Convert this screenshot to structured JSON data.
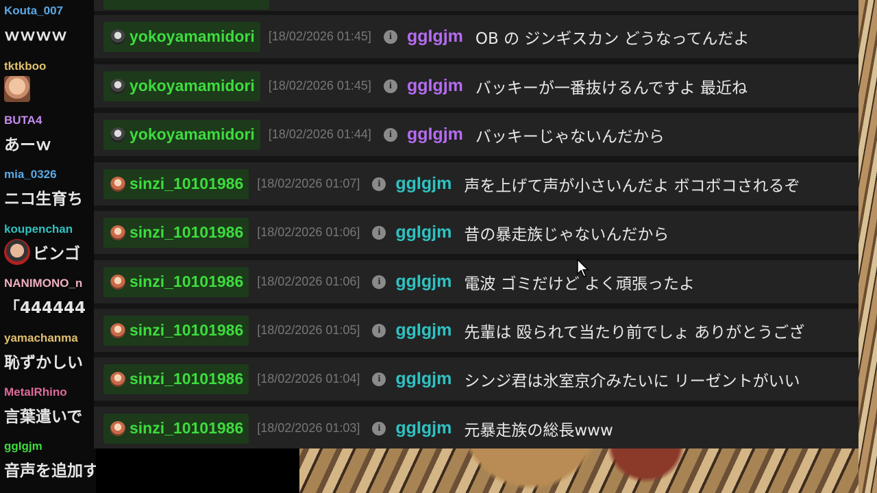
{
  "left_chat": [
    {
      "user": "Kouta_007",
      "user_color": "#5aa9e6",
      "text": "ｗｗｗｗ"
    },
    {
      "user": "tktkboo",
      "user_color": "#e0c070",
      "stamp": "face-stamp-icon"
    },
    {
      "user": "BUTA4",
      "user_color": "#c58bf0",
      "text": "あーｗ"
    },
    {
      "user": "mia_0326",
      "user_color": "#5aa9e6",
      "text": "ニコ生育ち"
    },
    {
      "user": "koupenchan",
      "user_color": "#2fc2c2",
      "text": "ビンゴ"
    },
    {
      "user": "NANIMONO_n",
      "user_color": "#f0b0c0",
      "text": "「444444"
    },
    {
      "user": "yamachanma",
      "user_color": "#e0c070",
      "text": "恥ずかしい"
    },
    {
      "user": "MetalRhino",
      "user_color": "#e06a9a",
      "text": "言葉遣いで"
    },
    {
      "user": "ggIgjm",
      "user_color": "#3ddc3d",
      "text": "音声を追加す"
    }
  ],
  "rows": [
    {
      "name": "yokoyamamidori",
      "icon": "yokoyama-avatar-icon",
      "timestamp": "[18/02/2026 01:45]",
      "to": "ggIgjm",
      "to_color": "purple",
      "message": "OB の ジンギスカン どうなってんだよ"
    },
    {
      "name": "yokoyamamidori",
      "icon": "yokoyama-avatar-icon",
      "timestamp": "[18/02/2026 01:45]",
      "to": "ggIgjm",
      "to_color": "purple",
      "message": "バッキーが一番抜けるんですよ 最近ね"
    },
    {
      "name": "yokoyamamidori",
      "icon": "yokoyama-avatar-icon",
      "timestamp": "[18/02/2026 01:44]",
      "to": "ggIgjm",
      "to_color": "purple",
      "message": "バッキーじゃないんだから"
    },
    {
      "name": "sinzi_10101986",
      "icon": "sinzi-avatar-icon",
      "timestamp": "[18/02/2026 01:07]",
      "to": "ggIgjm",
      "to_color": "teal",
      "message": "声を上げて声が小さいんだよ ボコボコされるぞ"
    },
    {
      "name": "sinzi_10101986",
      "icon": "sinzi-avatar-icon",
      "timestamp": "[18/02/2026 01:06]",
      "to": "ggIgjm",
      "to_color": "teal",
      "message": "昔の暴走族じゃないんだから"
    },
    {
      "name": "sinzi_10101986",
      "icon": "sinzi-avatar-icon",
      "timestamp": "[18/02/2026 01:06]",
      "to": "ggIgjm",
      "to_color": "teal",
      "message": "電波 ゴミだけど よく頑張ったよ"
    },
    {
      "name": "sinzi_10101986",
      "icon": "sinzi-avatar-icon",
      "timestamp": "[18/02/2026 01:05]",
      "to": "ggIgjm",
      "to_color": "teal",
      "message": "先輩は 殴られて当たり前でしょ ありがとうござ"
    },
    {
      "name": "sinzi_10101986",
      "icon": "sinzi-avatar-icon",
      "timestamp": "[18/02/2026 01:04]",
      "to": "ggIgjm",
      "to_color": "teal",
      "message": "シンジ君は氷室京介みたいに リーゼントがいい"
    },
    {
      "name": "sinzi_10101986",
      "icon": "sinzi-avatar-icon",
      "timestamp": "[18/02/2026 01:03]",
      "to": "ggIgjm",
      "to_color": "teal",
      "message": "元暴走族の総長www"
    }
  ],
  "colors": {
    "chip_bg": "#1d3a1b",
    "chip_name": "#3ddc3d",
    "purple": "#b56cf0",
    "teal": "#2fc2c2"
  },
  "icons": {
    "info": "info-icon",
    "cursor": "mouse-cursor-icon"
  }
}
